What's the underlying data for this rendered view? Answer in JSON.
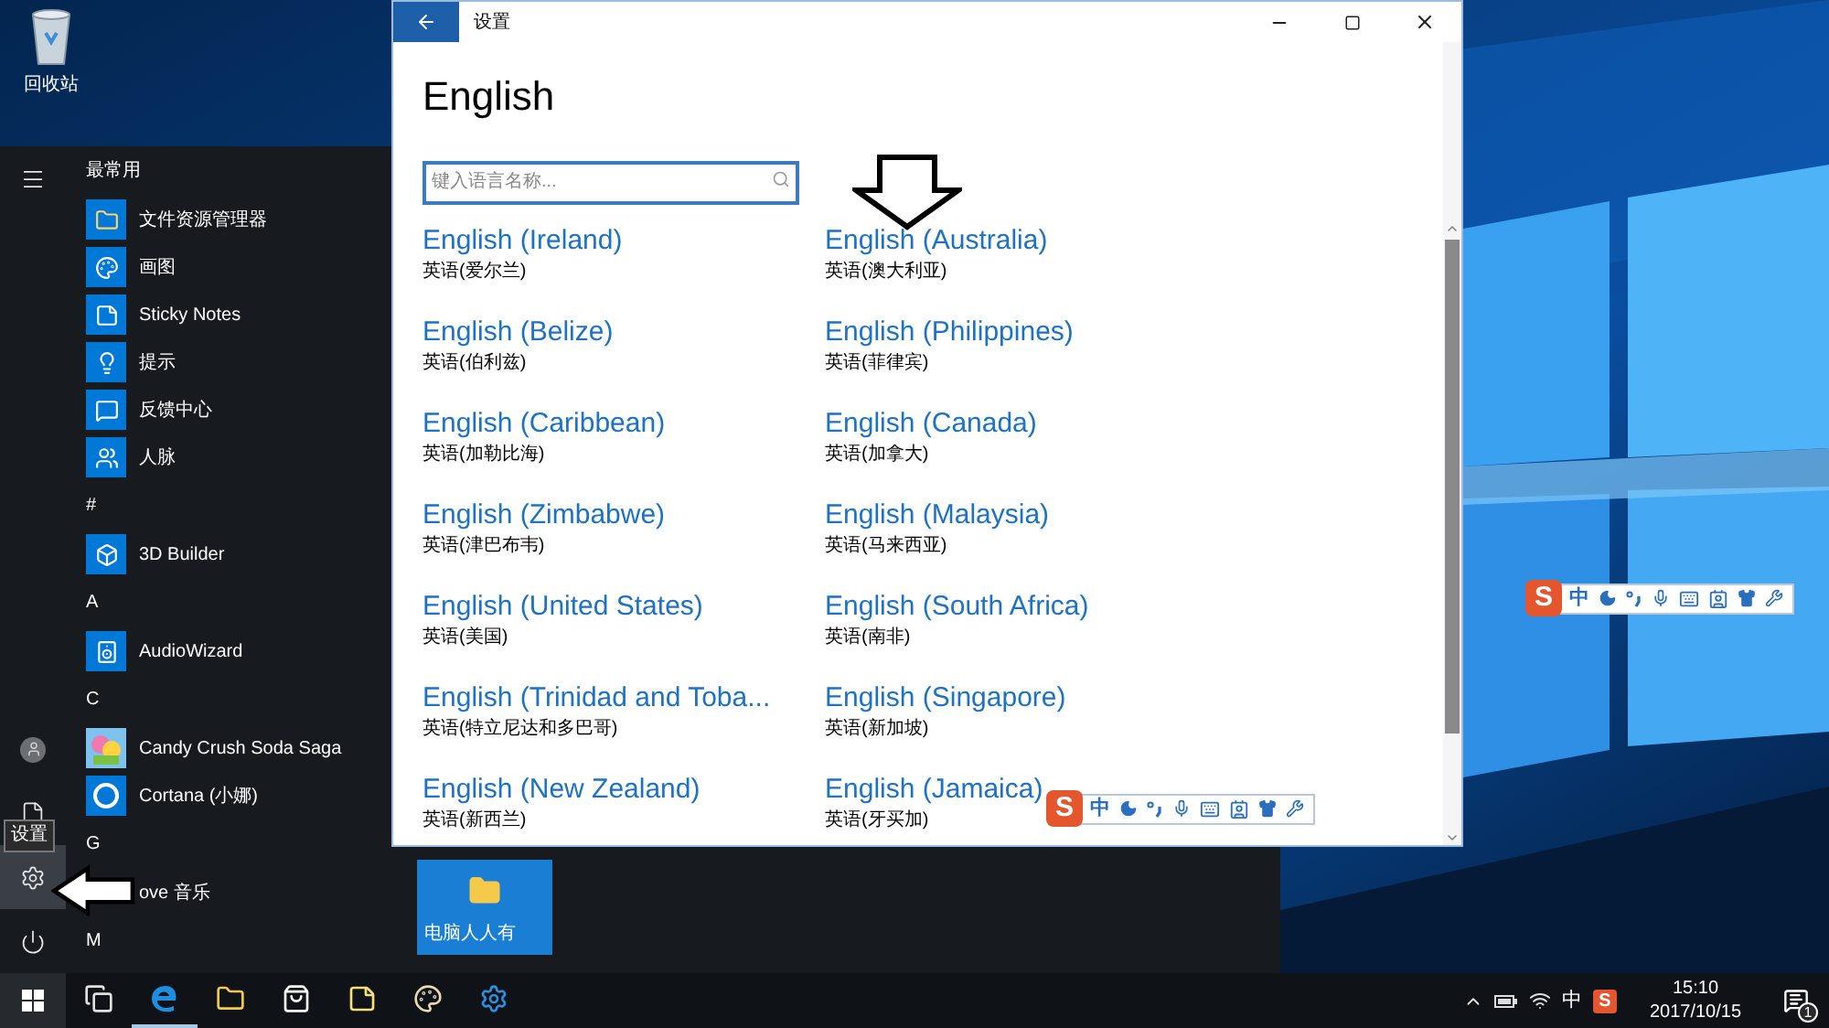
{
  "desktop": {
    "icons": [
      {
        "label": "回收站"
      }
    ]
  },
  "start_menu": {
    "rail": [
      {
        "kind": "menu",
        "selected": false
      },
      {
        "kind": "user",
        "selected": false
      },
      {
        "kind": "documents",
        "selected": false
      },
      {
        "kind": "settings",
        "selected": true
      },
      {
        "kind": "power",
        "selected": false
      }
    ],
    "tooltip": "设置",
    "apps": [
      {
        "kind": "header",
        "label": "最常用"
      },
      {
        "kind": "app",
        "label": "文件资源管理器"
      },
      {
        "kind": "app",
        "label": "画图"
      },
      {
        "kind": "app",
        "label": "Sticky Notes"
      },
      {
        "kind": "app",
        "label": "提示"
      },
      {
        "kind": "app",
        "label": "反馈中心"
      },
      {
        "kind": "app",
        "label": "人脉"
      },
      {
        "kind": "header",
        "label": "#"
      },
      {
        "kind": "app",
        "label": "3D Builder"
      },
      {
        "kind": "header",
        "label": "A"
      },
      {
        "kind": "app",
        "label": "AudioWizard"
      },
      {
        "kind": "header",
        "label": "C"
      },
      {
        "kind": "app",
        "label": "Candy Crush Soda Saga"
      },
      {
        "kind": "app",
        "label": "Cortana (小娜)"
      },
      {
        "kind": "header",
        "label": "G"
      },
      {
        "kind": "app",
        "label": "ove 音乐",
        "icon_hidden": true
      },
      {
        "kind": "header",
        "label": "M"
      }
    ],
    "tiles": [
      {
        "label": "电脑人人有"
      }
    ]
  },
  "settings_window": {
    "title": "设置",
    "heading": "English",
    "search": {
      "placeholder": "键入语言名称..."
    },
    "languages": [
      {
        "name": "English (Ireland)",
        "native": "英语(爱尔兰)"
      },
      {
        "name": "English (Australia)",
        "native": "英语(澳大利亚)"
      },
      {
        "name": "English (Belize)",
        "native": "英语(伯利兹)"
      },
      {
        "name": "English (Philippines)",
        "native": "英语(菲律宾)"
      },
      {
        "name": "English (Caribbean)",
        "native": "英语(加勒比海)"
      },
      {
        "name": "English (Canada)",
        "native": "英语(加拿大)"
      },
      {
        "name": "English (Zimbabwe)",
        "native": "英语(津巴布韦)"
      },
      {
        "name": "English (Malaysia)",
        "native": "英语(马来西亚)"
      },
      {
        "name": "English (United States)",
        "native": "英语(美国)"
      },
      {
        "name": "English (South Africa)",
        "native": "英语(南非)"
      },
      {
        "name": "English (Trinidad and Toba...",
        "native": "英语(特立尼达和多巴哥)"
      },
      {
        "name": "English (Singapore)",
        "native": "英语(新加坡)"
      },
      {
        "name": "English (New Zealand)",
        "native": "英语(新西兰)"
      },
      {
        "name": "English (Jamaica)",
        "native": "英语(牙买加)"
      }
    ]
  },
  "ime_toolbars": [
    {
      "logo": "S",
      "mode": "中"
    },
    {
      "logo": "S",
      "mode": "中"
    }
  ],
  "taskbar": {
    "apps": [
      {
        "kind": "task-view",
        "running": false
      },
      {
        "kind": "edge",
        "running": true
      },
      {
        "kind": "explorer",
        "running": false
      },
      {
        "kind": "store",
        "running": false
      },
      {
        "kind": "sticky-notes",
        "running": false
      },
      {
        "kind": "paint",
        "running": false
      },
      {
        "kind": "settings",
        "running": false
      }
    ],
    "tray": {
      "input_mode": "中",
      "ime_logo": "S",
      "time": "15:10",
      "date": "2017/10/15",
      "notifications": "1"
    }
  }
}
